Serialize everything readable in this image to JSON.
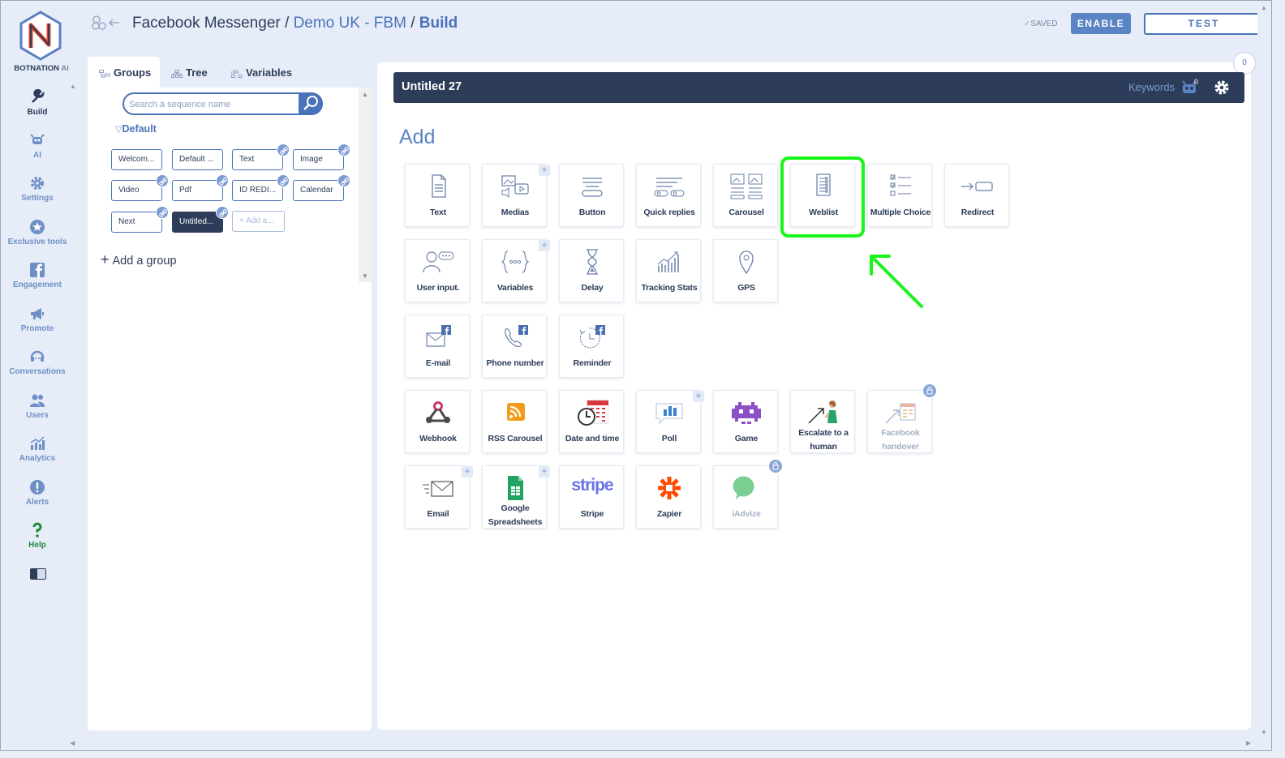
{
  "app": {
    "brand_name": "BOTNATION",
    "brand_suffix": " AI"
  },
  "nav": [
    {
      "label": "Build",
      "icon": "wrench-icon"
    },
    {
      "label": "AI",
      "icon": "robot-icon"
    },
    {
      "label": "Settings",
      "icon": "gear-icon"
    },
    {
      "label": "Exclusive tools",
      "icon": "star-icon"
    },
    {
      "label": "Engagement",
      "icon": "facebook-icon"
    },
    {
      "label": "Promote",
      "icon": "megaphone-icon"
    },
    {
      "label": "Conversations",
      "icon": "headset-icon"
    },
    {
      "label": "Users",
      "icon": "users-icon"
    },
    {
      "label": "Analytics",
      "icon": "chart-icon"
    },
    {
      "label": "Alerts",
      "icon": "alert-icon"
    },
    {
      "label": "Help",
      "icon": "question-icon"
    }
  ],
  "header": {
    "crumb_root": "Facebook Messenger",
    "sep": " / ",
    "crumb_bot": "Demo UK - FBM",
    "crumb_current": "Build",
    "saved": "SAVED",
    "enable": "ENABLE",
    "test": "TEST"
  },
  "left_panel": {
    "tabs": [
      {
        "label": "Groups",
        "icon": "groups-icon"
      },
      {
        "label": "Tree",
        "icon": "tree-icon"
      },
      {
        "label": "Variables",
        "icon": "variables-icon"
      }
    ],
    "search_placeholder": "Search a sequence name",
    "group_name": "Default",
    "sequences": [
      {
        "label": "Welcom...",
        "linked": false
      },
      {
        "label": "Default ...",
        "linked": false
      },
      {
        "label": "Text",
        "linked": true
      },
      {
        "label": "Image",
        "linked": true
      },
      {
        "label": "Video",
        "linked": true
      },
      {
        "label": "Pdf",
        "linked": true
      },
      {
        "label": "ID REDI...",
        "linked": true
      },
      {
        "label": "Calendar",
        "linked": true
      },
      {
        "label": "Next",
        "linked": true
      },
      {
        "label": "Untitled...",
        "linked": true,
        "active": true
      },
      {
        "label": "Add a...",
        "add": true
      }
    ],
    "add_group": "Add a group"
  },
  "main": {
    "sequence_title": "Untitled 27",
    "keywords_label": "Keywords",
    "keywords_count": "0",
    "counter": "0",
    "add_heading": "Add",
    "cards": [
      {
        "label": "Text",
        "icon": "text-doc-icon"
      },
      {
        "label": "Medias",
        "icon": "medias-icon",
        "plus": true
      },
      {
        "label": "Button",
        "icon": "button-icon"
      },
      {
        "label": "Quick replies",
        "icon": "quick-replies-icon"
      },
      {
        "label": "Carousel",
        "icon": "carousel-icon"
      },
      {
        "label": "Weblist",
        "icon": "weblist-icon",
        "highlighted": true
      },
      {
        "label": "Multiple Choice",
        "icon": "multiple-choice-icon"
      },
      {
        "label": "Redirect",
        "icon": "redirect-icon"
      },
      {
        "label": "User input.",
        "icon": "user-input-icon"
      },
      {
        "label": "Variables",
        "icon": "variables-braces-icon",
        "plus": true
      },
      {
        "label": "Delay",
        "icon": "hourglass-icon"
      },
      {
        "label": "Tracking Stats",
        "icon": "tracking-stats-icon"
      },
      {
        "label": "GPS",
        "icon": "gps-pin-icon"
      },
      {
        "label": "E-mail",
        "icon": "email-fb-icon"
      },
      {
        "label": "Phone number",
        "icon": "phone-fb-icon"
      },
      {
        "label": "Reminder",
        "icon": "reminder-fb-icon"
      },
      {
        "label": "Webhook",
        "icon": "webhook-icon"
      },
      {
        "label": "RSS Carousel",
        "icon": "rss-icon"
      },
      {
        "label": "Date and time",
        "icon": "date-time-icon"
      },
      {
        "label": "Poll",
        "icon": "poll-icon",
        "plus": true
      },
      {
        "label": "Game",
        "icon": "game-invader-icon"
      },
      {
        "label": "Escalate to a human",
        "icon": "escalate-human-icon"
      },
      {
        "label": "Facebook handover",
        "icon": "facebook-handover-icon",
        "locked": true,
        "disabled": true
      },
      {
        "label": "Email",
        "icon": "email-envelope-icon",
        "plus": true
      },
      {
        "label": "Google Spreadsheets",
        "icon": "google-sheets-icon",
        "plus": true
      },
      {
        "label": "Stripe",
        "icon": "stripe-logo-icon",
        "logo_text": "stripe"
      },
      {
        "label": "Zapier",
        "icon": "zapier-icon"
      },
      {
        "label": "iAdvize",
        "icon": "iadvize-icon",
        "locked": true,
        "disabled": true
      }
    ]
  },
  "colors": {
    "accent": "#4a72b8",
    "navy": "#2d3d59",
    "highlight": "#19f519"
  }
}
